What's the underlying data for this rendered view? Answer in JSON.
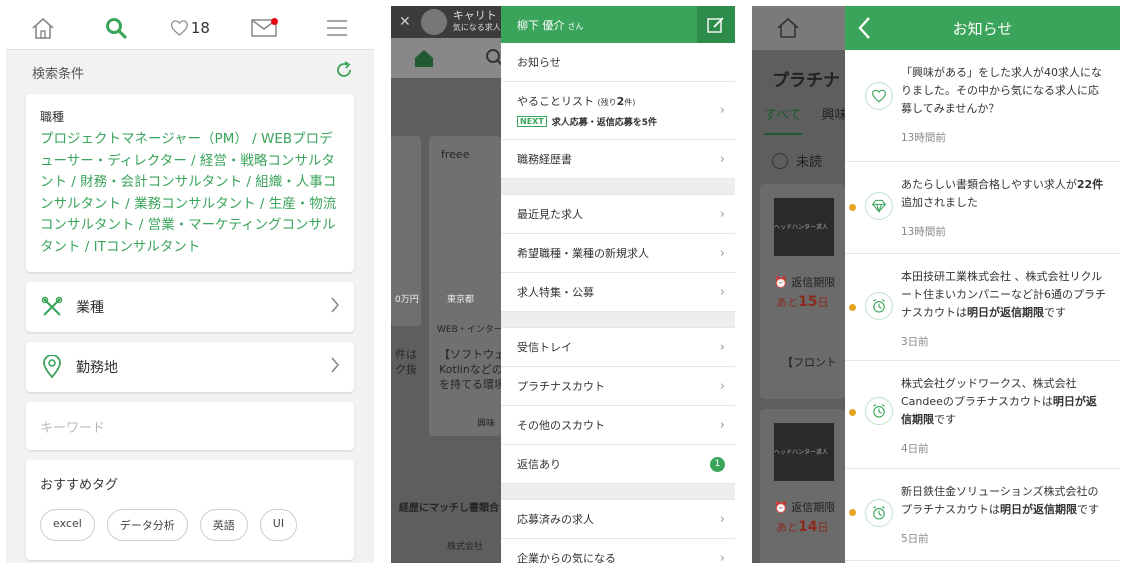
{
  "screen1": {
    "header": {
      "favorites_count": "18"
    },
    "search_conditions_label": "検索条件",
    "job_type": {
      "label": "職種",
      "value": "プロジェクトマネージャー（PM） / WEBプロデューサー・ディレクター / 経営・戦略コンサルタント / 財務・会計コンサルタント / 組織・人事コンサルタント / 業務コンサルタント / 生産・物流コンサルタント / 営業・マーケティングコンサルタント / ITコンサルタント"
    },
    "industry_label": "業種",
    "location_label": "勤務地",
    "keyword_placeholder": "キーワード",
    "recommended_tags": {
      "label": "おすすめタグ",
      "tags": [
        "excel",
        "データ分析",
        "英語",
        "UI"
      ]
    }
  },
  "screen2": {
    "bg": {
      "app_name": "キャリト",
      "app_sub": "気になる求人",
      "tile_brand": "freee",
      "tile_salary": "0万円",
      "tile_location": "東京都",
      "tile_category": "WEB・インター",
      "tile_text_a": "件は",
      "tile_text_b": "ク抜",
      "tile_text_c": "【ソフトウェ",
      "tile_text_d": "Kotlinなどの",
      "tile_text_e": "を持てる環境",
      "tile_action": "興味",
      "bottom_text": "経歴にマッチし書類合",
      "company_text": "株式会社"
    },
    "drawer": {
      "user_name": "柳下 優介",
      "honorific": "さん",
      "items": {
        "notices": "お知らせ",
        "todo_label": "やることリスト",
        "todo_remaining_prefix": "(残り",
        "todo_remaining_count": "2",
        "todo_remaining_suffix": "件)",
        "next_badge": "NEXT",
        "next_text": "求人応募・返信応募を5件",
        "resume": "職務経歴書",
        "recent_jobs": "最近見た求人",
        "new_jobs": "希望職種・業種の新規求人",
        "features": "求人特集・公募",
        "inbox": "受信トレイ",
        "platinum_scout": "プラチナスカウト",
        "other_scout": "その他のスカウト",
        "replied": "返信あり",
        "replied_count": "1",
        "applied": "応募済みの求人",
        "company_interest": "企業からの気になる"
      }
    }
  },
  "screen3": {
    "bg": {
      "title": "プラチナ",
      "tab_all": "すべて",
      "tab_interest": "興味",
      "unread_label": "未読",
      "thumb_label": "ヘッドハンター求人",
      "deadline_label": "返信期限",
      "deadline_1_prefix": "あと",
      "deadline_1_days": "15",
      "deadline_1_suffix": "日",
      "deadline_2_prefix": "あと",
      "deadline_2_days": "14",
      "deadline_2_suffix": "日",
      "card_text": "【フロント"
    },
    "notices": {
      "title": "お知らせ",
      "items": [
        {
          "icon": "heart-icon",
          "unread": false,
          "text": "「興味がある」をした求人が40求人になりました。その中から気になる求人に応募してみませんか？",
          "time": "13時間前"
        },
        {
          "icon": "diamond-icon",
          "unread": true,
          "text_a": "あたらしい書類合格しやすい求人が",
          "text_b": "22件",
          "text_c": "追加されました",
          "time": "13時間前"
        },
        {
          "icon": "alarm-icon",
          "unread": true,
          "text_a": "本田技研工業株式会社 、株式会社リクルート住まいカンパニーなど計6通のプラチナスカウトは",
          "text_b": "明日が返信期限",
          "text_c": "です",
          "time": "3日前"
        },
        {
          "icon": "alarm-icon",
          "unread": true,
          "text_a": "株式会社グッドワークス、株式会社Candeeのプラチナスカウトは",
          "text_b": "明日が返信期限",
          "text_c": "です",
          "time": "4日前"
        },
        {
          "icon": "alarm-icon",
          "unread": true,
          "text_a": "新日鉄住金ソリューションズ株式会社のプラチナスカウトは",
          "text_b": "明日が返信期限",
          "text_c": "です",
          "time": "5日前"
        }
      ]
    }
  },
  "colors": {
    "accent_green": "#3aa45b",
    "unread_dot": "#e5a520",
    "notification_red": "#e60012"
  }
}
